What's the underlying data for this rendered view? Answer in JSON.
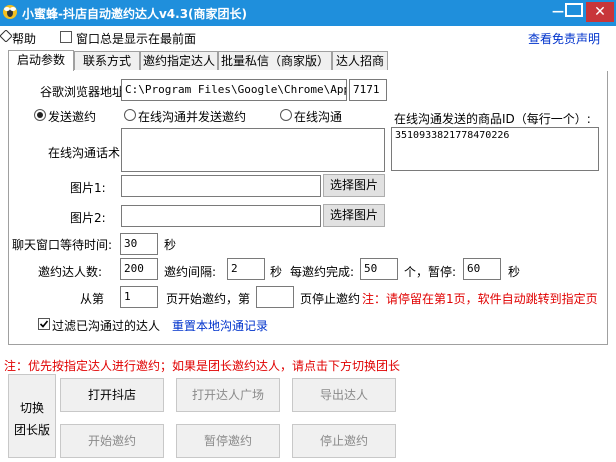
{
  "window": {
    "title": "小蜜蜂-抖店自动邀约达人v4.3(商家团长)",
    "minimize_label": "—",
    "close_label": "✕"
  },
  "menu": {
    "help": "帮助",
    "always_on_top": "窗口总是显示在最前面",
    "always_on_top_checked": false,
    "disclaimer": "查看免责声明"
  },
  "tabs": [
    {
      "label": "启动参数",
      "active": true
    },
    {
      "label": "联系方式",
      "active": false
    },
    {
      "label": "邀约指定达人",
      "active": false
    },
    {
      "label": "批量私信（商家版）",
      "active": false
    },
    {
      "label": "达人招商",
      "active": false
    }
  ],
  "form": {
    "browser_label": "谷歌浏览器地址:",
    "browser_path": "C:\\Program Files\\Google\\Chrome\\Applica",
    "port": "7171",
    "radio_send_invite": "发送邀约",
    "radio_chat_and_invite": "在线沟通并发送邀约",
    "radio_chat": "在线沟通",
    "selected_mode": "发送邀约",
    "product_id_label": "在线沟通发送的商品ID（每行一个）:",
    "product_ids": "3510933821778470226",
    "chat_script_label": "在线沟通话术:",
    "chat_script": "",
    "image1_label": "图片1:",
    "image1_value": "",
    "image2_label": "图片2:",
    "image2_value": "",
    "choose_image_label": "选择图片",
    "chat_wait_label": "聊天窗口等待时间:",
    "chat_wait_value": "30",
    "seconds_unit": "秒",
    "invite_count_label": "邀约达人数:",
    "invite_count_value": "200",
    "invite_interval_label": "邀约间隔:",
    "invite_interval_value": "2",
    "per_complete_label": "每邀约完成:",
    "per_complete_value": "50",
    "count_unit_pause": "个，暂停:",
    "pause_value": "60",
    "from_label": "从第",
    "start_page_value": "1",
    "start_page_label": "页开始邀约，第",
    "stop_page_value": "",
    "stop_page_label": "页停止邀约",
    "page_note": "注：请停留在第1页，软件自动跳转到指定页",
    "filter_label": "过滤已沟通过的达人",
    "filter_checked": true,
    "reset_records": "重置本地沟通记录"
  },
  "footer": {
    "note": "注：优先按指定达人进行邀约；如果是团长邀约达人，请点击下方切换团长",
    "switch_line1": "切换",
    "switch_line2": "团长版",
    "open_store": "打开抖店",
    "open_plaza": "打开达人广场",
    "export": "导出达人",
    "start_invite": "开始邀约",
    "pause_invite": "暂停邀约",
    "stop_invite": "停止邀约"
  },
  "colors": {
    "titlebar": "#1f8fdc",
    "close": "#c8363a",
    "link": "#0033cc",
    "warning": "#e00000"
  }
}
